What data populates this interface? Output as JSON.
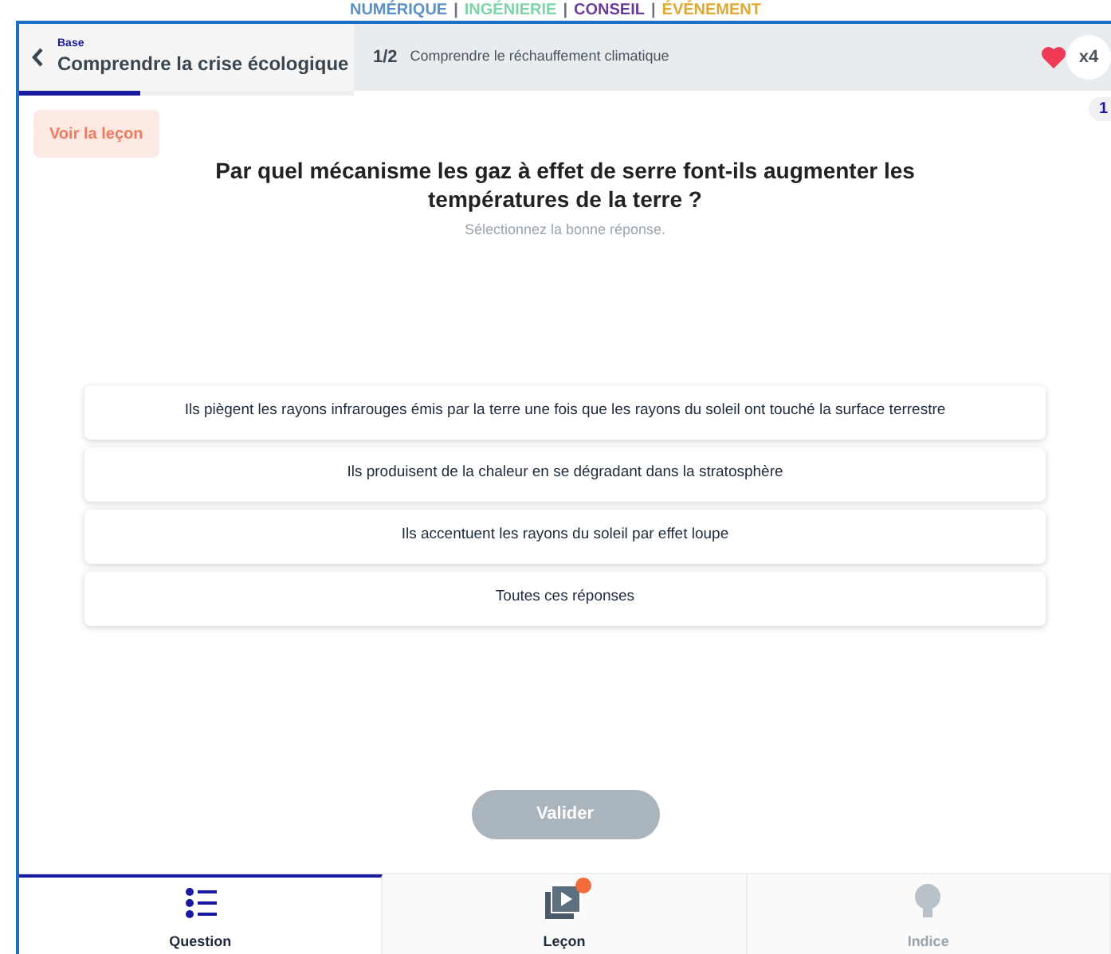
{
  "banner_separator": "|",
  "banner": [
    {
      "text": "NUMÉRIQUE",
      "color": "#5b8fc7"
    },
    {
      "text": "INGÉNIERIE",
      "color": "#7fd3a8"
    },
    {
      "text": "CONSEIL",
      "color": "#6a3d9a"
    },
    {
      "text": "ÉVÉNEMENT",
      "color": "#e0a82e"
    }
  ],
  "header": {
    "breadcrumb": "Base",
    "title": "Comprendre la crise écologique",
    "step": "1/2",
    "subtitle": "Comprendre le réchauffement climatique",
    "lives": "x4",
    "progress": {
      "level": 0.36
    },
    "page_badge": "1"
  },
  "lesson_button": "Voir la leçon",
  "question": "Par quel mécanisme les gaz à effet de serre font-ils augmenter les températures de la terre ?",
  "instruction": "Sélectionnez la bonne réponse.",
  "answers": [
    {
      "text": "Ils piègent les rayons infrarouges émis par la terre une fois que les rayons du soleil ont touché la surface terrestre",
      "selected": false
    },
    {
      "text": "Ils produisent de la chaleur en se dégradant dans la stratosphère",
      "selected": false
    },
    {
      "text": "Ils accentuent les rayons du soleil par effet loupe",
      "selected": false
    },
    {
      "text": "Toutes ces réponses",
      "selected": false
    }
  ],
  "submit": {
    "label": "Valider",
    "disabled": true
  },
  "tabs": [
    {
      "kind": "question",
      "label": "Question",
      "selected": true,
      "disabled": false,
      "notification": false
    },
    {
      "kind": "lesson",
      "label": "Leçon",
      "selected": false,
      "disabled": false,
      "notification": true
    },
    {
      "kind": "hint",
      "label": "Indice",
      "selected": false,
      "disabled": true,
      "notification": false
    }
  ]
}
